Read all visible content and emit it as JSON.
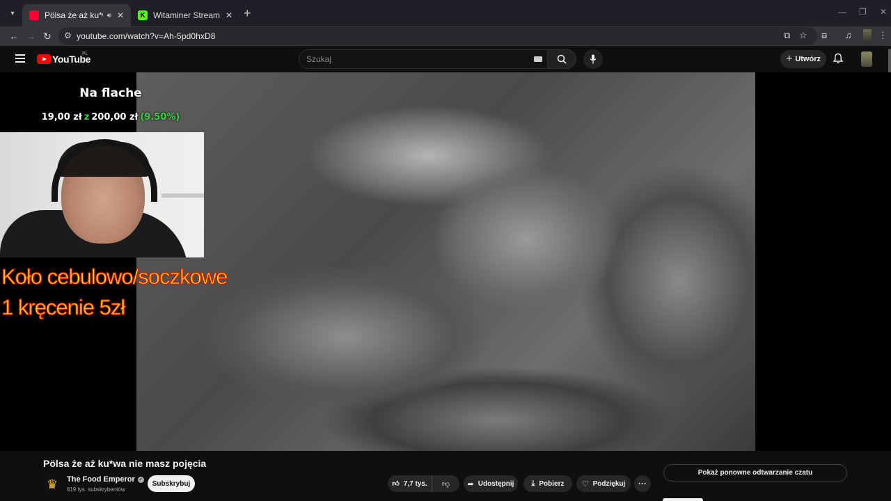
{
  "browser": {
    "tabs": [
      {
        "title": "Pölsa że aż ku*wa nie masz",
        "favicon_color": "#ff0033",
        "active": true,
        "audio": true
      },
      {
        "title": "Witaminer Stream - Watch Live",
        "favicon_color": "#53fc18",
        "active": false,
        "audio": false
      }
    ],
    "url": "youtube.com/watch?v=Ah-5pd0hxD8"
  },
  "masthead": {
    "logo_text": "YouTube",
    "country_code": "PL",
    "search_placeholder": "Szukaj",
    "create_label": "Utwórz"
  },
  "overlay": {
    "title": "Na flache",
    "goal_current": "19,00 zł",
    "goal_of": "z",
    "goal_target": "200,00 zł",
    "goal_percent": "(9.50%)",
    "wheel_line1": "Koło cebulowo/soczkowe",
    "wheel_line2": "1 kręcenie 5zł"
  },
  "video": {
    "title": "Pölsa że aż ku*wa nie masz pojęcia",
    "channel_name": "The Food Emperor",
    "subscribers": "619 tys. subskrybentów",
    "subscribe_label": "Subskrybuj",
    "likes": "7,7 tys.",
    "share_label": "Udostępnij",
    "download_label": "Pobierz",
    "thanks_label": "Podziękuj",
    "chat_replay_label": "Pokaż ponowne odtwarzanie czatu"
  },
  "colors": {
    "youtube_red": "#ff0000",
    "goal_green": "#37d13f",
    "wheel_yellow": "#ffdf19",
    "wheel_outline": "#e11a00"
  }
}
